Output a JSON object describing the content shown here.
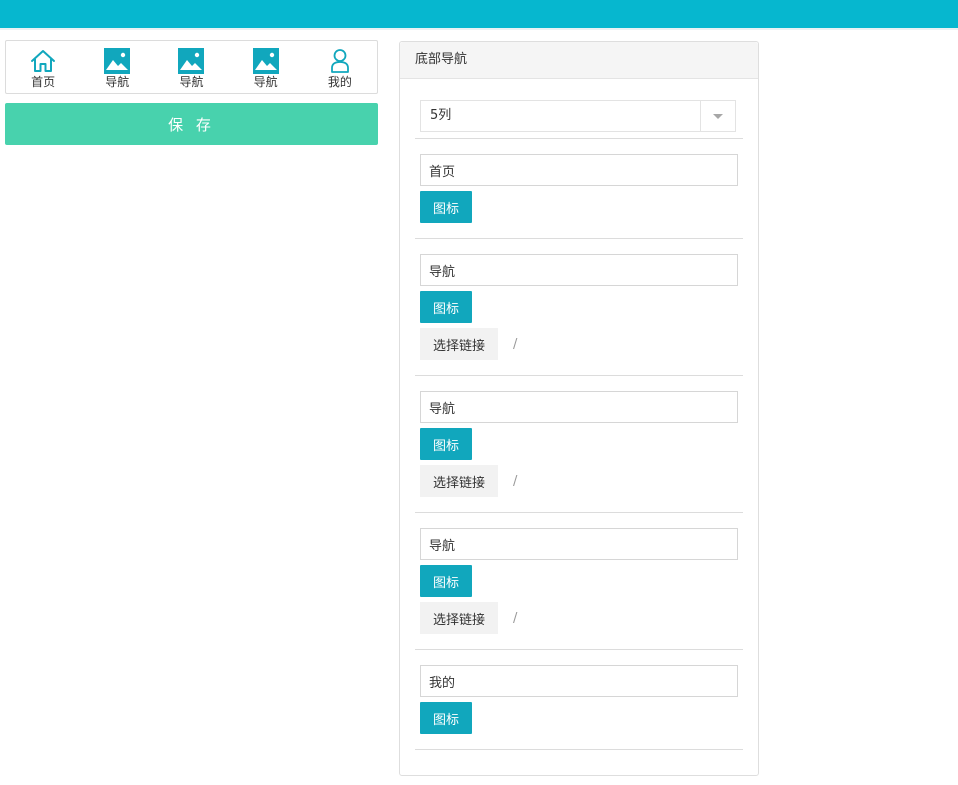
{
  "preview": {
    "items": [
      {
        "label": "首页",
        "icon": "home-icon"
      },
      {
        "label": "导航",
        "icon": "image-icon"
      },
      {
        "label": "导航",
        "icon": "image-icon"
      },
      {
        "label": "导航",
        "icon": "image-icon"
      },
      {
        "label": "我的",
        "icon": "user-icon"
      }
    ],
    "save_label": "保 存"
  },
  "panel": {
    "title": "底部导航",
    "columns_select": "5列",
    "items": [
      {
        "name": "首页",
        "icon_button": "图标"
      },
      {
        "name": "导航",
        "icon_button": "图标",
        "link_button": "选择链接",
        "link": "/"
      },
      {
        "name": "导航",
        "icon_button": "图标",
        "link_button": "选择链接",
        "link": "/"
      },
      {
        "name": "导航",
        "icon_button": "图标",
        "link_button": "选择链接",
        "link": "/"
      },
      {
        "name": "我的",
        "icon_button": "图标"
      }
    ]
  },
  "colors": {
    "topbar": "#06b7cf",
    "accent": "#11a7bd",
    "save": "#48d2ad"
  }
}
